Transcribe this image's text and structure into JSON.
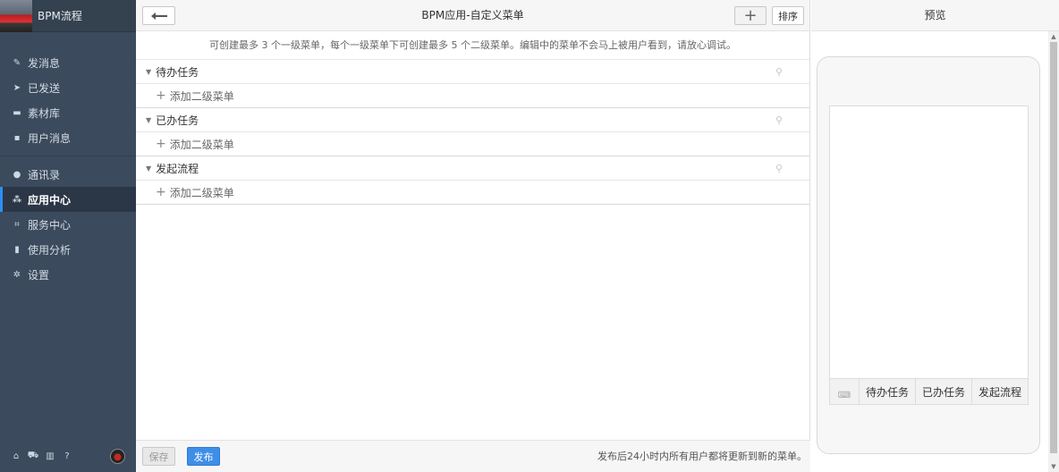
{
  "app": {
    "name": "BPM流程"
  },
  "sidebar": {
    "group1": [
      {
        "label": "发消息",
        "icon": "pencil-icon"
      },
      {
        "label": "已发送",
        "icon": "send-icon"
      },
      {
        "label": "素材库",
        "icon": "folder-icon"
      },
      {
        "label": "用户消息",
        "icon": "chat-icon"
      }
    ],
    "group2": [
      {
        "label": "通讯录",
        "icon": "contacts-icon"
      },
      {
        "label": "应用中心",
        "icon": "apps-icon",
        "active": true
      },
      {
        "label": "服务中心",
        "icon": "service-icon"
      },
      {
        "label": "使用分析",
        "icon": "bar-chart-icon"
      },
      {
        "label": "设置",
        "icon": "gear-icon"
      }
    ],
    "footer_icons": [
      "home-icon",
      "cart-icon",
      "book-icon",
      "help-icon"
    ]
  },
  "editor": {
    "title": "BPM应用-自定义菜单",
    "sort_label": "排序",
    "tip": "可创建最多 3 个一级菜单，每个一级菜单下可创建最多 5 个二级菜单。编辑中的菜单不会马上被用户看到，请放心调试。",
    "menus": [
      {
        "label": "待办任务",
        "add_sub": "添加二级菜单"
      },
      {
        "label": "已办任务",
        "add_sub": "添加二级菜单"
      },
      {
        "label": "发起流程",
        "add_sub": "添加二级菜单"
      }
    ],
    "save_label": "保存",
    "publish_label": "发布",
    "publish_note": "发布后24小时内所有用户都将更新到新的菜单。"
  },
  "preview": {
    "title": "预览",
    "menu_items": [
      "待办任务",
      "已办任务",
      "发起流程"
    ]
  },
  "colors": {
    "sidebar_bg": "#3b4a5d",
    "accent": "#2f8ef4",
    "publish_button": "#3e8ee8"
  }
}
